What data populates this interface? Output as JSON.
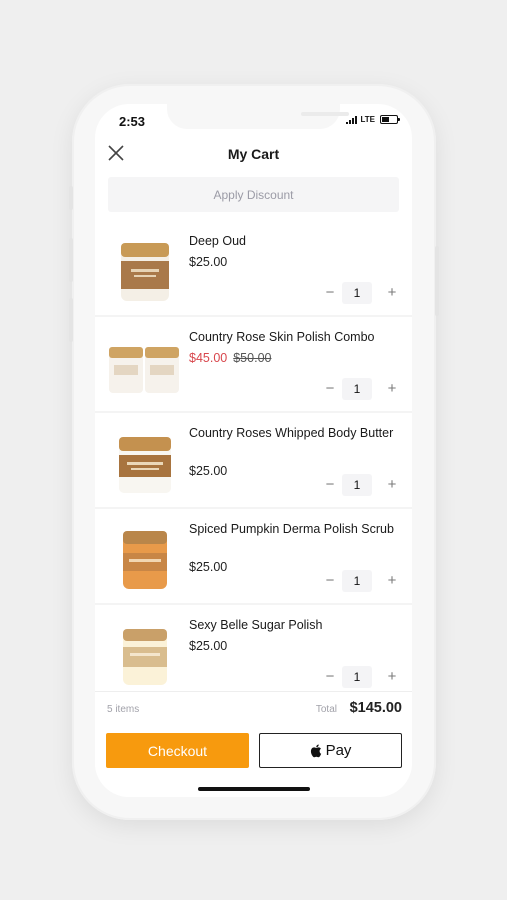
{
  "status": {
    "time": "2:53",
    "network": "LTE"
  },
  "header": {
    "title": "My Cart"
  },
  "discount": {
    "label": "Apply Discount"
  },
  "cart": {
    "items": [
      {
        "name": "Deep Oud",
        "price": "$25.00",
        "qty": "1"
      },
      {
        "name": "Country Rose Skin Polish Combo",
        "sale_price": "$45.00",
        "original_price": "$50.00",
        "qty": "1"
      },
      {
        "name": "Country Roses Whipped Body Butter",
        "price": "$25.00",
        "qty": "1"
      },
      {
        "name": "Spiced Pumpkin Derma Polish Scrub",
        "price": "$25.00",
        "qty": "1"
      },
      {
        "name": "Sexy Belle Sugar Polish",
        "price": "$25.00",
        "qty": "1"
      }
    ],
    "controls": {
      "minus": "−",
      "plus": "+"
    }
  },
  "footer": {
    "items_count": "5 items",
    "total_label": "Total",
    "total_value": "$145.00",
    "checkout_label": "Checkout",
    "applepay_label": "Pay"
  },
  "colors": {
    "accent": "#f79a0e",
    "sale": "#d8464c"
  }
}
